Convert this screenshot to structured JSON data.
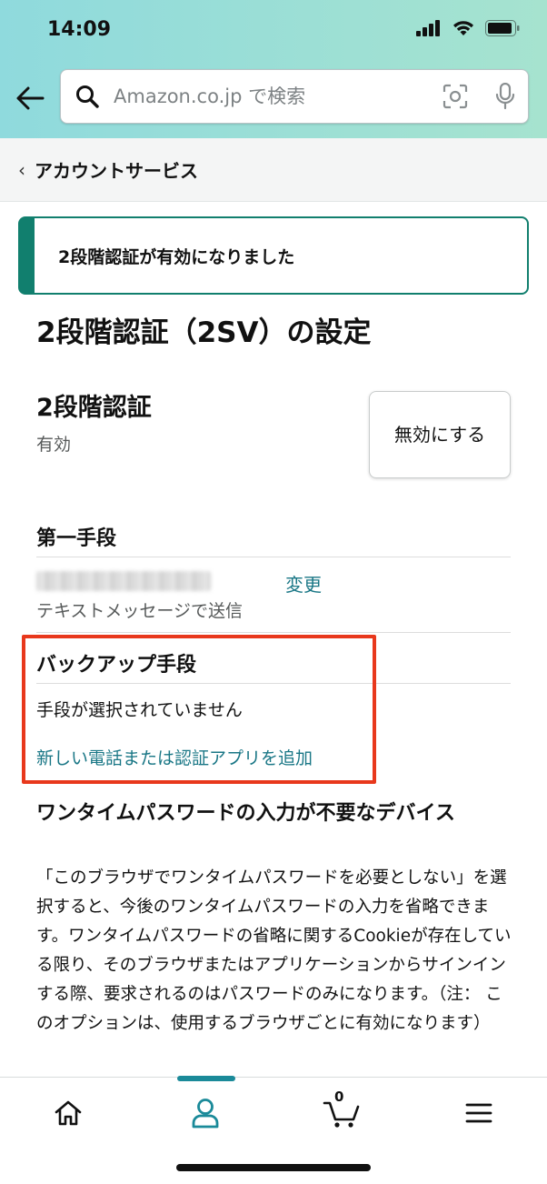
{
  "status_bar": {
    "time": "14:09"
  },
  "search": {
    "placeholder": "Amazon.co.jp で検索"
  },
  "breadcrumb": {
    "label": "アカウントサービス"
  },
  "alert": {
    "text": "2段階認証が有効になりました"
  },
  "page": {
    "title": "2段階認証（2SV）の設定"
  },
  "two_step": {
    "title": "2段階認証",
    "status": "有効",
    "disable_label": "無効にする"
  },
  "primary_method": {
    "title": "第一手段",
    "change_label": "変更",
    "delivery": "テキストメッセージで送信"
  },
  "backup_method": {
    "title": "バックアップ手段",
    "status": "手段が選択されていません",
    "add_link": "新しい電話または認証アプリを追加"
  },
  "otp_section": {
    "title": "ワンタイムパスワードの入力が不要なデバイス",
    "body": "「このブラウザでワンタイムパスワードを必要としない」を選択すると、今後のワンタイムパスワードの入力を省略できます。ワンタイムパスワードの省略に関するCookieが存在している限り、そのブラウザまたはアプリケーションからサインインする際、要求されるのはパスワードのみになります。（注： このオプションは、使用するブラウザごとに有効になります）"
  },
  "bottom_nav": {
    "items": [
      {
        "icon": "home-icon"
      },
      {
        "icon": "account-icon"
      },
      {
        "icon": "cart-icon"
      },
      {
        "icon": "menu-icon"
      }
    ],
    "cart_count": "0"
  },
  "colors": {
    "header_start": "#8fdadd",
    "header_end": "#a6e3cf",
    "accent": "#117f6e",
    "link": "#1a7786",
    "highlight": "#e8381c",
    "nav_active": "#1a8a99"
  }
}
